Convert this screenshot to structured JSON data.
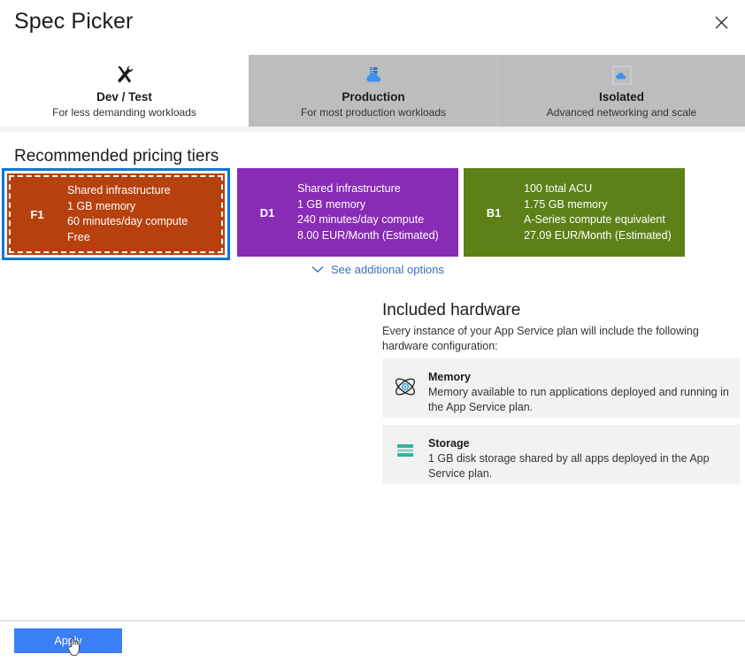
{
  "window": {
    "title": "Spec Picker",
    "close_icon": "close-icon"
  },
  "tabs": [
    {
      "id": "dev-test",
      "label": "Dev / Test",
      "sublabel": "For less demanding workloads",
      "icon": "tools-icon",
      "active": true
    },
    {
      "id": "production",
      "label": "Production",
      "sublabel": "For most production workloads",
      "icon": "server-cloud-icon",
      "active": false
    },
    {
      "id": "isolated",
      "label": "Isolated",
      "sublabel": "Advanced networking and scale",
      "icon": "isolated-cloud-icon",
      "active": false
    }
  ],
  "tiers_section": {
    "heading": "Recommended pricing tiers"
  },
  "tiers": [
    {
      "code": "F1",
      "selected": true,
      "color": "#b7410e",
      "lines": [
        "Shared infrastructure",
        "1 GB memory",
        "60 minutes/day compute",
        "Free"
      ]
    },
    {
      "code": "D1",
      "selected": false,
      "color": "#882bb5",
      "lines": [
        "Shared infrastructure",
        "1 GB memory",
        "240 minutes/day compute",
        "8.00 EUR/Month (Estimated)"
      ]
    },
    {
      "code": "B1",
      "selected": false,
      "color": "#5d8018",
      "lines": [
        "100 total ACU",
        "1.75 GB memory",
        "A-Series compute equivalent",
        "27.09 EUR/Month (Estimated)"
      ]
    }
  ],
  "see_more": {
    "label": "See additional options",
    "icon": "chevron-down-icon"
  },
  "hardware": {
    "heading": "Included hardware",
    "description": "Every instance of your App Service plan will include the following hardware configuration:",
    "items": [
      {
        "id": "memory",
        "icon": "memory-atom-icon",
        "title": "Memory",
        "body": "Memory available to run applications deployed and running in the App Service plan."
      },
      {
        "id": "storage",
        "icon": "storage-disk-icon",
        "title": "Storage",
        "body": "1 GB disk storage shared by all apps deployed in the App Service plan."
      }
    ]
  },
  "footer": {
    "apply_label": "Apply"
  },
  "colors": {
    "accent": "#0078d4",
    "apply_button": "#3b7ff5",
    "link": "#3b6fb6",
    "tab_inactive_bg": "#bdbdbd",
    "hardware_card_bg": "#f2f2f2"
  }
}
